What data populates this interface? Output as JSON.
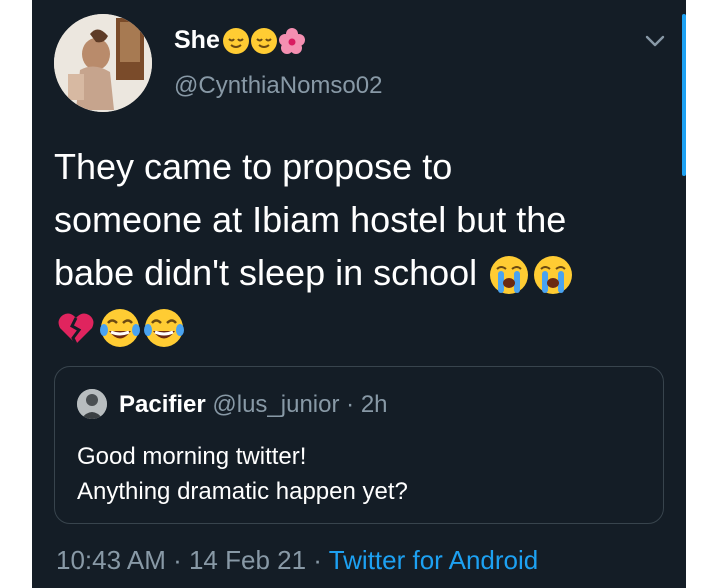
{
  "tweet": {
    "display_name": "She",
    "name_emojis": [
      "relieved-face-emoji",
      "relieved-face-emoji",
      "hibiscus-emoji"
    ],
    "handle": "@CynthiaNomso02",
    "text_lines": [
      "They came to propose to",
      "someone at Ibiam hostel but the",
      "babe didn't sleep in school"
    ],
    "line3_emojis": [
      "loudly-crying-face-emoji",
      "loudly-crying-face-emoji"
    ],
    "line4_emojis": [
      "broken-heart-emoji",
      "tears-of-joy-emoji",
      "tears-of-joy-emoji"
    ]
  },
  "quote": {
    "name": "Pacifier",
    "handle": "@lus_junior",
    "separator": " · ",
    "time": "2h",
    "text_lines": [
      "Good morning twitter!",
      "Anything dramatic happen yet?"
    ]
  },
  "meta": {
    "time": "10:43 AM",
    "sep1": " · ",
    "date": "14 Feb 21",
    "sep2": " · ",
    "source": "Twitter for Android"
  },
  "colors": {
    "background": "#141d26",
    "text": "#ffffff",
    "secondary": "#8899a6",
    "accent": "#1da1f2",
    "border": "#38444d"
  }
}
